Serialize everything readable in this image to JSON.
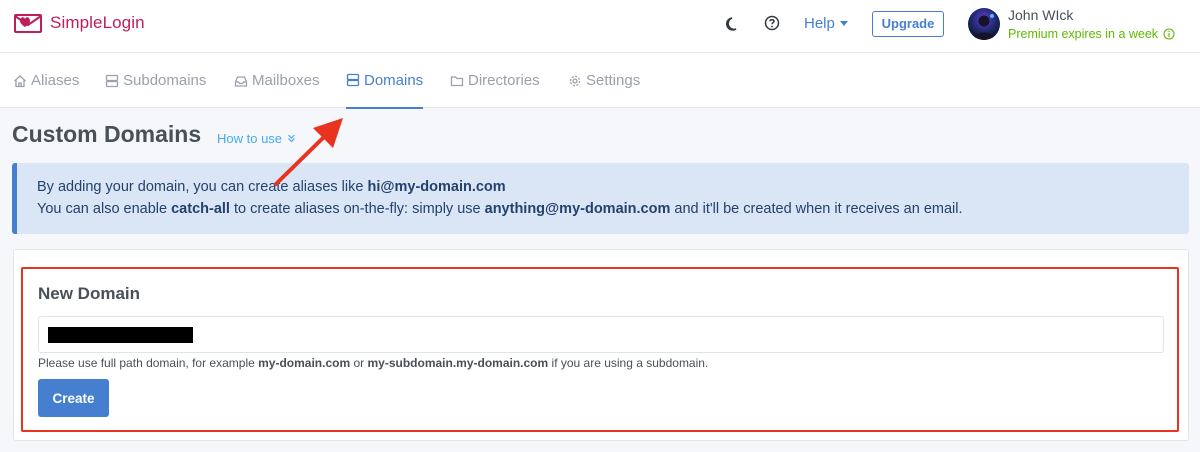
{
  "brand": {
    "name": "SimpleLogin",
    "color": "#be1e5b"
  },
  "header": {
    "theme_icon": "moon-icon",
    "help_icon": "question-circle-icon",
    "help_label": "Help",
    "upgrade_label": "Upgrade",
    "user_name": "John WIck",
    "premium_status": "Premium expires in a week"
  },
  "nav": {
    "items": [
      {
        "label": "Aliases",
        "icon": "home-icon"
      },
      {
        "label": "Subdomains",
        "icon": "server-icon"
      },
      {
        "label": "Mailboxes",
        "icon": "inbox-icon"
      },
      {
        "label": "Domains",
        "icon": "server-icon",
        "active": true
      },
      {
        "label": "Directories",
        "icon": "folder-icon"
      },
      {
        "label": "Settings",
        "icon": "gear-icon"
      }
    ]
  },
  "page": {
    "title": "Custom Domains",
    "how_to_label": "How to use"
  },
  "info": {
    "line1_text": "By adding your domain, you can create aliases like ",
    "line1_bold": "hi@my-domain.com",
    "line2_a": "You can also enable ",
    "line2_bold1": "catch-all",
    "line2_b": " to create aliases on-the-fly: simply use ",
    "line2_bold2": "anything@my-domain.com",
    "line2_c": " and it'll be created when it receives an email."
  },
  "new_domain": {
    "title": "New Domain",
    "input_value": "",
    "hint_a": "Please use full path domain, for example ",
    "hint_bold1": "my-domain.com",
    "hint_b": " or ",
    "hint_bold2": "my-subdomain.my-domain.com",
    "hint_c": " if you are using a subdomain.",
    "create_label": "Create"
  },
  "colors": {
    "accent": "#467fcf",
    "premium": "#5eba00",
    "annotation": "#e8331f",
    "info_bg": "#dae5f5"
  }
}
